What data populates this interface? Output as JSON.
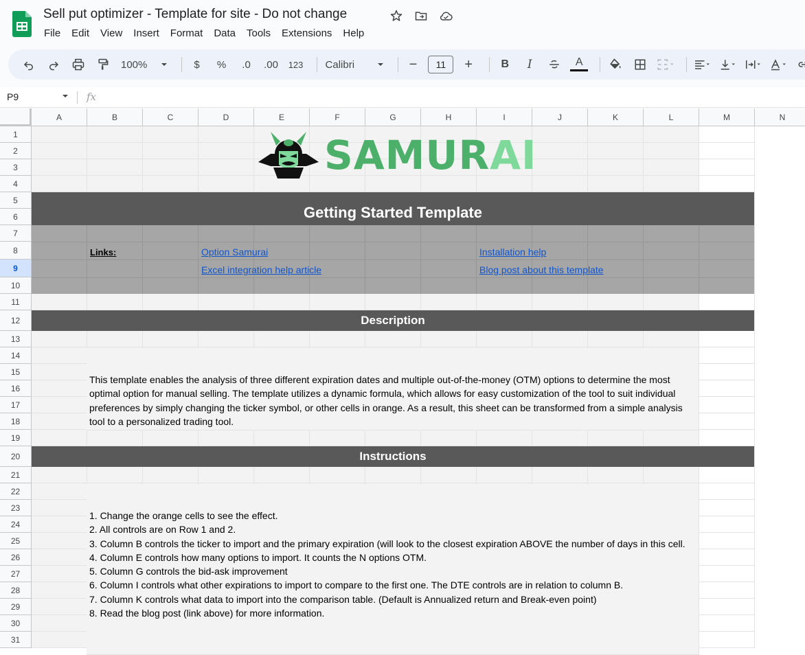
{
  "doc": {
    "title": "Sell put optimizer - Template for site - Do not change"
  },
  "menu": [
    "File",
    "Edit",
    "View",
    "Insert",
    "Format",
    "Data",
    "Tools",
    "Extensions",
    "Help"
  ],
  "toolbar": {
    "zoom": "100%",
    "currency": "$",
    "percent": "%",
    "dec_decrease": ".0",
    "dec_increase": ".00",
    "number_format": "123",
    "font": "Calibri",
    "font_size": "11",
    "bold": "B",
    "italic": "I",
    "text_color": "A",
    "minus": "−",
    "plus": "+"
  },
  "formula_bar": {
    "cell_ref": "P9",
    "fx": "fx",
    "value": ""
  },
  "columns": [
    "A",
    "B",
    "C",
    "D",
    "E",
    "F",
    "G",
    "H",
    "I",
    "J",
    "K",
    "L",
    "M",
    "N"
  ],
  "rows": [
    "1",
    "2",
    "3",
    "4",
    "5",
    "6",
    "7",
    "8",
    "9",
    "10",
    "11",
    "12",
    "13",
    "14",
    "15",
    "16",
    "17",
    "18",
    "19",
    "20",
    "21",
    "22",
    "23",
    "24",
    "25",
    "26",
    "27",
    "28",
    "29",
    "30",
    "31"
  ],
  "selected": {
    "row": "9"
  },
  "sheet": {
    "logo_text_a": "SAMUR",
    "logo_text_b": "AI",
    "header_title": "Getting Started Template",
    "links_label": "Links:",
    "link_option_samurai": "Option Samurai",
    "link_installation": "Installation help",
    "link_excel": "Excel integration help article",
    "link_blog": "Blog post about this template",
    "description_title": "Description",
    "description_text": "This template enables the analysis of three different expiration dates and multiple out-of-the-money (OTM) options to determine the most optimal option for manual selling. The template utilizes a dynamic formula, which allows for easy customization of the tool to suit individual preferences by simply changing the ticker symbol, or other cells in orange. As a result, this sheet can be transformed from a simple analysis tool to a personalized trading tool.",
    "instructions_title": "Instructions",
    "instructions": [
      "1. Change the orange cells to see the effect.",
      "2. All controls are on Row 1 and 2.",
      "3. Column B controls the ticker to import and the primary expiration (will look to the closest expiration ABOVE the number of days in this cell.",
      "4. Column E controls how many options to import. It counts the N options OTM.",
      "5. Column G controls the bid-ask improvement",
      "6. Column I controls what other expirations to import to compare to the first one. The DTE controls are in relation to column B.",
      "7. Column K controls what data to import into the comparison table. (Default is Annualized return and Break-even point)",
      "8. Read the blog post (link above) for more information."
    ]
  },
  "colors": {
    "band": "#595959",
    "link_band": "#a6a6a6",
    "link": "#1155cc",
    "logo_green": "#4caf6a",
    "logo_light_green": "#7fd99a",
    "sheets_green": "#0f9d58"
  }
}
